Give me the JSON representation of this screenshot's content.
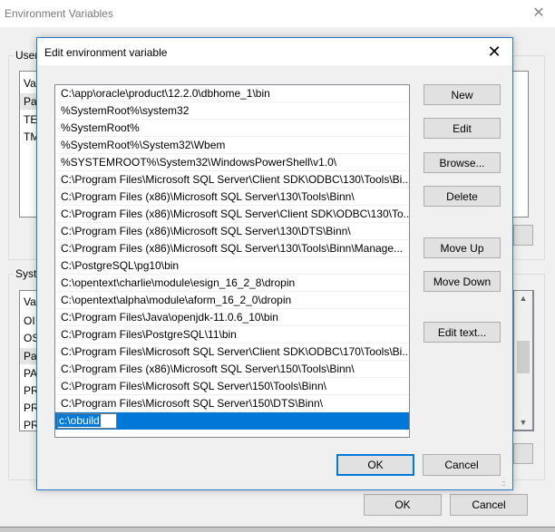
{
  "background_window": {
    "title": "Environment Variables",
    "close_icon": "close-icon",
    "user_group_label": "User",
    "user_list": {
      "header": "Va",
      "rows": [
        "Pa",
        "TE",
        "TM"
      ]
    },
    "system_group_label": "Syste",
    "system_list": {
      "header": "Va",
      "rows": [
        "OI",
        "OS",
        "Pa",
        "PA",
        "PR",
        "PR",
        "PR"
      ]
    },
    "ok_label": "OK",
    "cancel_label": "Cancel"
  },
  "dialog": {
    "title": "Edit environment variable",
    "close_icon": "close-icon",
    "paths": [
      "C:\\app\\oracle\\product\\12.2.0\\dbhome_1\\bin",
      "%SystemRoot%\\system32",
      "%SystemRoot%",
      "%SystemRoot%\\System32\\Wbem",
      "%SYSTEMROOT%\\System32\\WindowsPowerShell\\v1.0\\",
      "C:\\Program Files\\Microsoft SQL Server\\Client SDK\\ODBC\\130\\Tools\\Bi...",
      "C:\\Program Files (x86)\\Microsoft SQL Server\\130\\Tools\\Binn\\",
      "C:\\Program Files (x86)\\Microsoft SQL Server\\Client SDK\\ODBC\\130\\To...",
      "C:\\Program Files (x86)\\Microsoft SQL Server\\130\\DTS\\Binn\\",
      "C:\\Program Files (x86)\\Microsoft SQL Server\\130\\Tools\\Binn\\Manage...",
      "C:\\PostgreSQL\\pg10\\bin",
      "C:\\opentext\\charlie\\module\\esign_16_2_8\\dropin",
      "C:\\opentext\\alpha\\module\\aform_16_2_0\\dropin",
      "C:\\Program Files\\Java\\openjdk-11.0.6_10\\bin",
      "C:\\Program Files\\PostgreSQL\\11\\bin",
      "C:\\Program Files\\Microsoft SQL Server\\Client SDK\\ODBC\\170\\Tools\\Bi...",
      "C:\\Program Files (x86)\\Microsoft SQL Server\\150\\Tools\\Binn\\",
      "C:\\Program Files\\Microsoft SQL Server\\150\\Tools\\Binn\\",
      "C:\\Program Files\\Microsoft SQL Server\\150\\DTS\\Binn\\"
    ],
    "editing_value": "c:\\obuild",
    "buttons": {
      "new": "New",
      "edit": "Edit",
      "browse": "Browse...",
      "delete": "Delete",
      "move_up": "Move Up",
      "move_down": "Move Down",
      "edit_text": "Edit text...",
      "ok": "OK",
      "cancel": "Cancel"
    }
  },
  "colors": {
    "accent": "#0078d7",
    "dialog_border": "#2b79c2"
  }
}
